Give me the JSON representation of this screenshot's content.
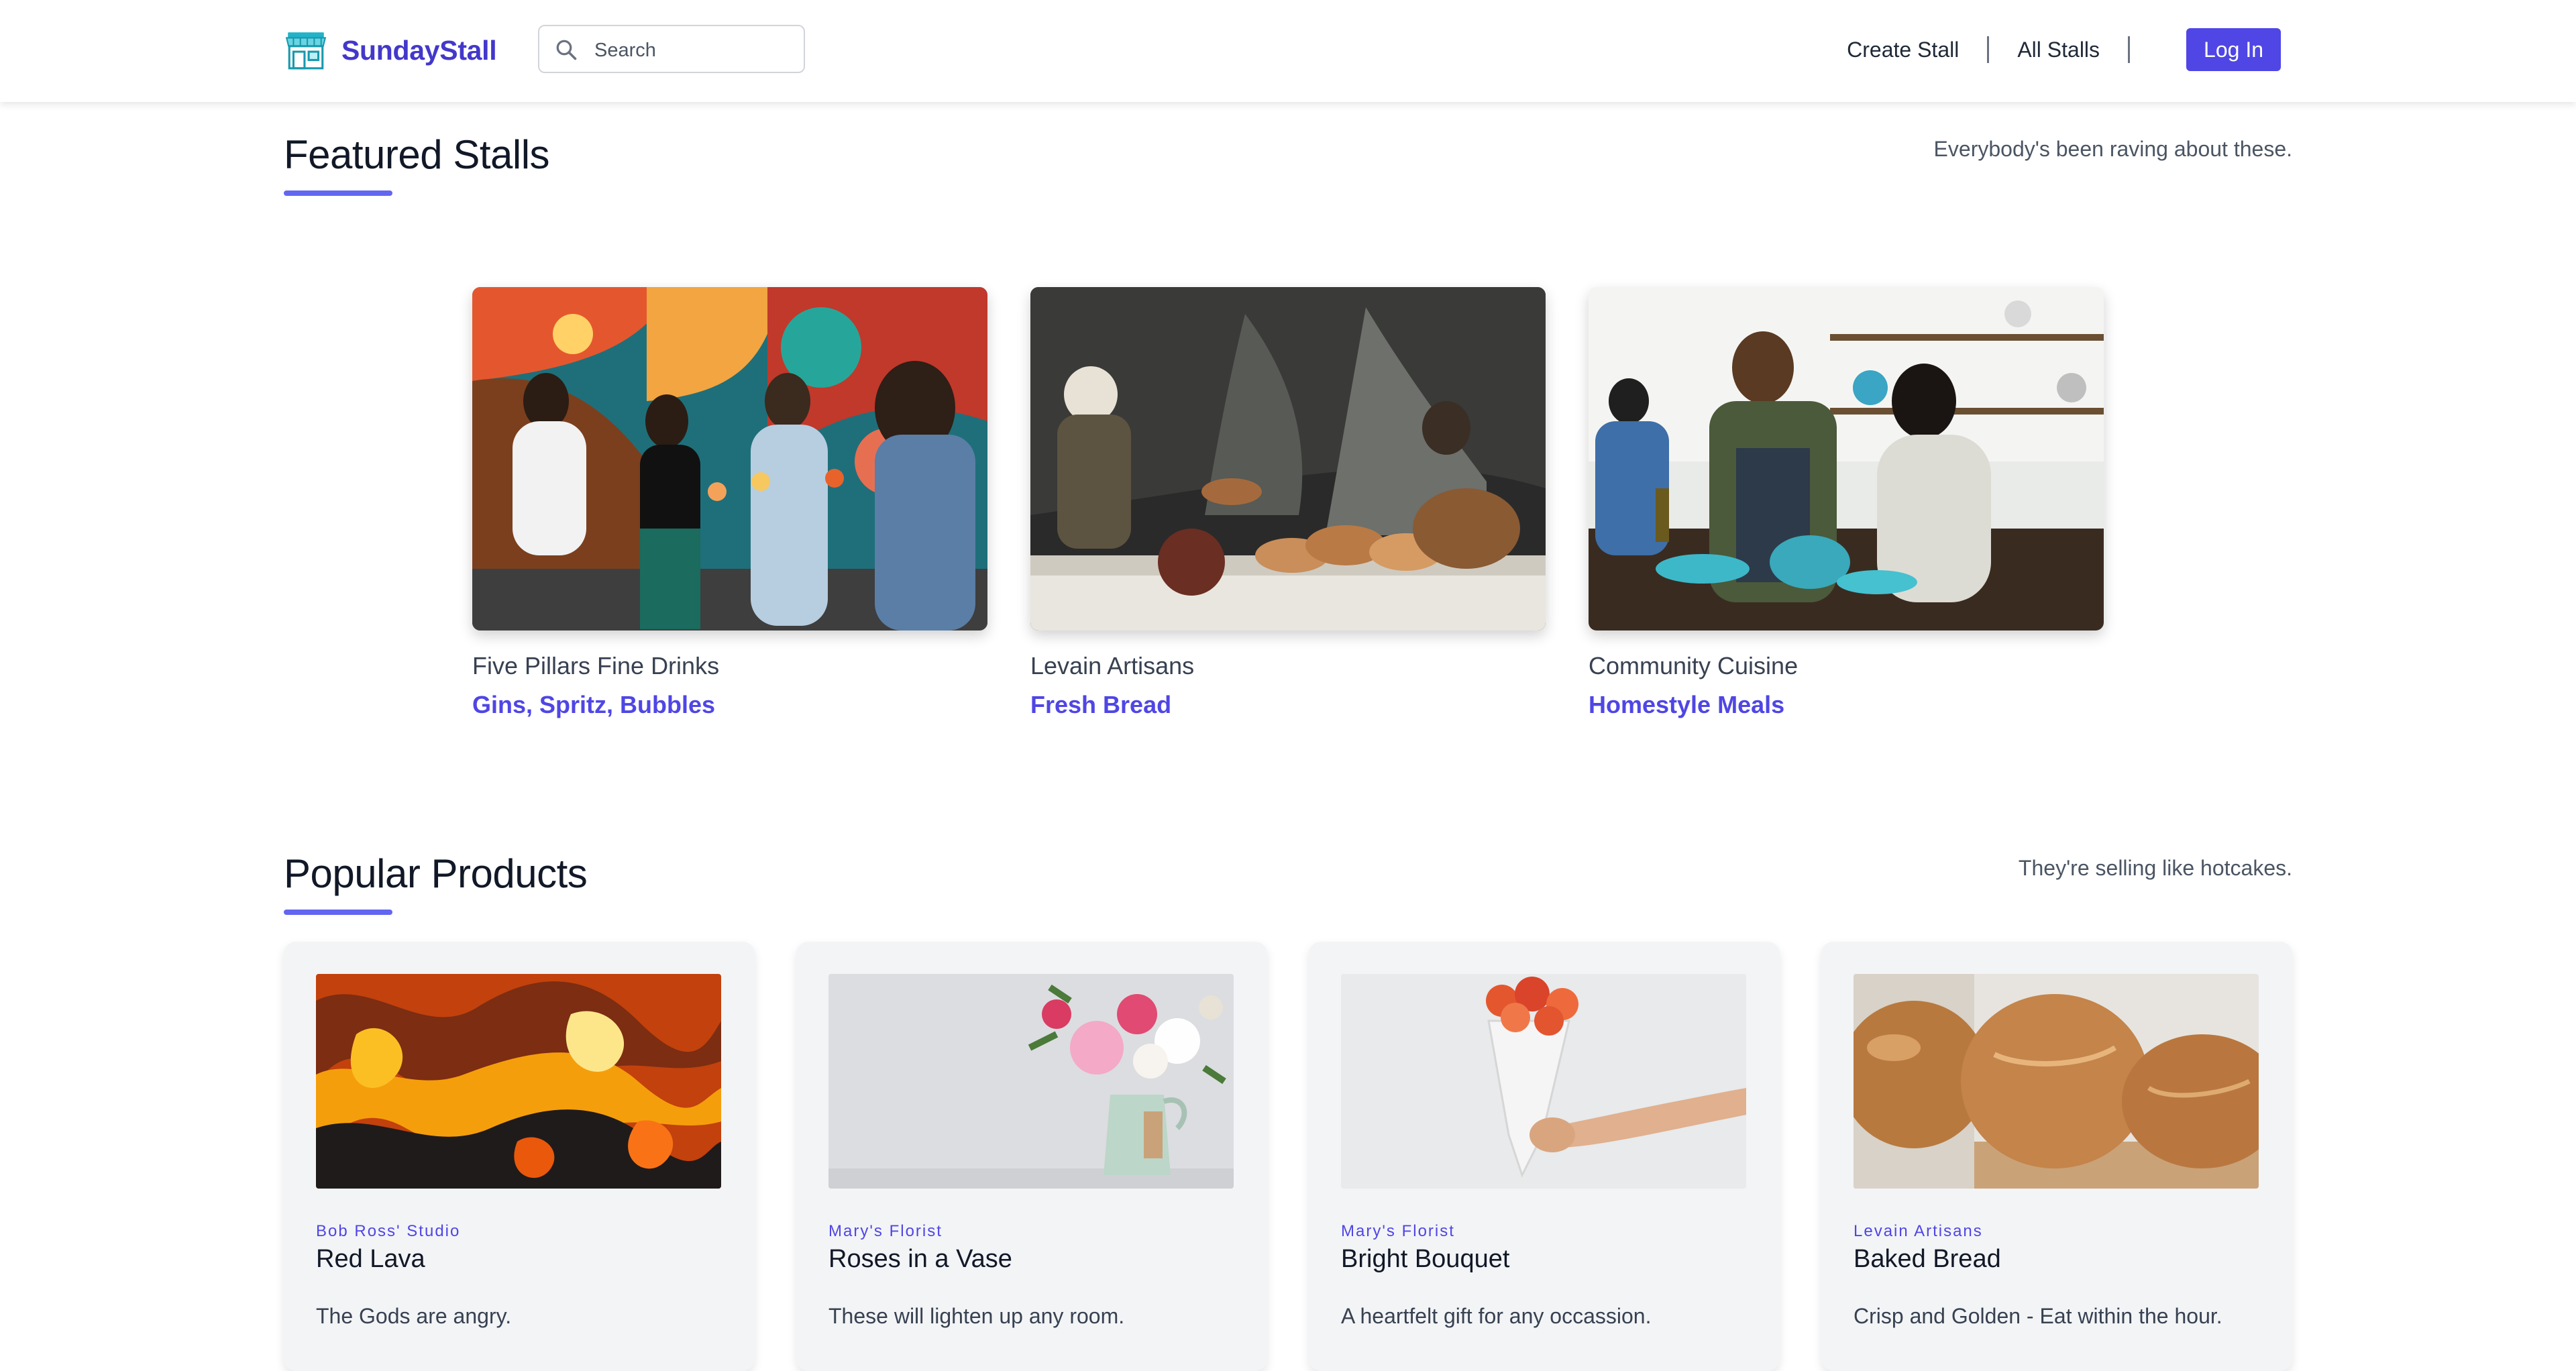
{
  "brand": {
    "name": "SundayStall"
  },
  "search": {
    "placeholder": "Search"
  },
  "nav": {
    "create_stall": "Create Stall",
    "all_stalls": "All Stalls",
    "log_in": "Log In"
  },
  "featured": {
    "title": "Featured Stalls",
    "tagline": "Everybody's been raving about these.",
    "stalls": [
      {
        "name": "Five Pillars Fine Drinks",
        "tags": "Gins, Spritz, Bubbles"
      },
      {
        "name": "Levain Artisans",
        "tags": "Fresh Bread"
      },
      {
        "name": "Community Cuisine",
        "tags": "Homestyle Meals"
      }
    ]
  },
  "popular": {
    "title": "Popular Products",
    "tagline": "They're selling like hotcakes.",
    "products": [
      {
        "stall": "Bob Ross' Studio",
        "name": "Red Lava",
        "desc": "The Gods are angry."
      },
      {
        "stall": "Mary's Florist",
        "name": "Roses in a Vase",
        "desc": "These will lighten up any room."
      },
      {
        "stall": "Mary's Florist",
        "name": "Bright Bouquet",
        "desc": "A heartfelt gift for any occassion."
      },
      {
        "stall": "Levain Artisans",
        "name": "Baked Bread",
        "desc": "Crisp and Golden - Eat within the hour."
      }
    ]
  },
  "colors": {
    "accent": "#4f46e5",
    "brand": "#4338ca",
    "underline": "#6366f1"
  },
  "icons": {
    "logo": "storefront-icon",
    "search": "search-icon"
  }
}
